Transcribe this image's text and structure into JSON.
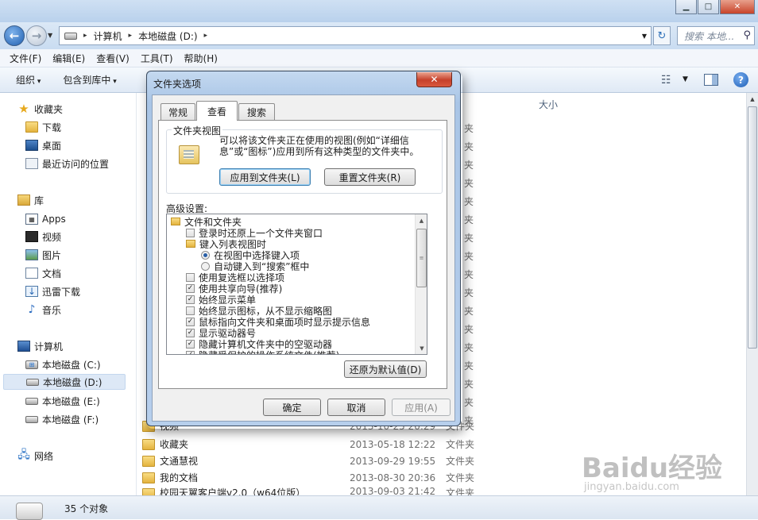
{
  "window": {
    "controls": {
      "minimize": "▁",
      "maximize": "□",
      "close": "✕"
    }
  },
  "address": {
    "crumbs": [
      "计算机",
      "本地磁盘 (D:)"
    ],
    "search_placeholder": "搜索 本地..."
  },
  "menu": [
    "文件(F)",
    "编辑(E)",
    "查看(V)",
    "工具(T)",
    "帮助(H)"
  ],
  "toolbar": {
    "organize": "组织",
    "include_in_library": "包含到库中",
    "help": "?"
  },
  "nav": {
    "favorites": "收藏夹",
    "downloads": "下载",
    "desktop": "桌面",
    "recent": "最近访问的位置",
    "libraries": "库",
    "apps": "Apps",
    "videos": "视频",
    "pictures": "图片",
    "documents": "文档",
    "thunder": "迅雷下载",
    "music": "音乐",
    "computer": "计算机",
    "drive_c": "本地磁盘 (C:)",
    "drive_d": "本地磁盘 (D:)",
    "drive_e": "本地磁盘 (E:)",
    "drive_f": "本地磁盘 (F:)",
    "network": "网络"
  },
  "content": {
    "size_header": "大小",
    "hidden_type_fragment": "夹",
    "rows": [
      {
        "name": "视频",
        "date": "2013-10-25 20:29",
        "type": "文件夹"
      },
      {
        "name": "收藏夹",
        "date": "2013-05-18 12:22",
        "type": "文件夹"
      },
      {
        "name": "文通慧视",
        "date": "2013-09-29 19:55",
        "type": "文件夹"
      },
      {
        "name": "我的文档",
        "date": "2013-08-30 20:36",
        "type": "文件夹"
      },
      {
        "name": "校园天翼客户端v2.0（w64位版）",
        "date": "2013-09-03 21:42",
        "type": "文件夹"
      }
    ]
  },
  "status": {
    "count": "35 个对象"
  },
  "watermark": {
    "brand": "Baidu经验",
    "url": "jingyan.baidu.com"
  },
  "dialog": {
    "title": "文件夹选项",
    "close": "✕",
    "tabs": [
      "常规",
      "查看",
      "搜索"
    ],
    "folder_views": {
      "legend": "文件夹视图",
      "text": "可以将该文件夹正在使用的视图(例如“详细信息”或“图标”)应用到所有这种类型的文件夹中。",
      "apply_button": "应用到文件夹(L)",
      "reset_button": "重置文件夹(R)"
    },
    "advanced_label": "高级设置:",
    "tree": [
      {
        "label": "文件和文件夹",
        "kind": "folder"
      },
      {
        "label": "登录时还原上一个文件夹窗口",
        "kind": "check",
        "checked": false
      },
      {
        "label": "键入列表视图时",
        "kind": "folder"
      },
      {
        "label": "在视图中选择键入项",
        "kind": "radio",
        "checked": true
      },
      {
        "label": "自动键入到“搜索”框中",
        "kind": "radio",
        "checked": false
      },
      {
        "label": "使用复选框以选择项",
        "kind": "check",
        "checked": false
      },
      {
        "label": "使用共享向导(推荐)",
        "kind": "check",
        "checked": true
      },
      {
        "label": "始终显示菜单",
        "kind": "check",
        "checked": true
      },
      {
        "label": "始终显示图标，从不显示缩略图",
        "kind": "check",
        "checked": false
      },
      {
        "label": "鼠标指向文件夹和桌面项时显示提示信息",
        "kind": "check",
        "checked": true
      },
      {
        "label": "显示驱动器号",
        "kind": "check",
        "checked": true
      },
      {
        "label": "隐藏计算机文件夹中的空驱动器",
        "kind": "check",
        "checked": true
      },
      {
        "label": "隐藏受保护的操作系统文件(推荐)",
        "kind": "check",
        "checked": true
      }
    ],
    "restore_defaults": "还原为默认值(D)",
    "ok": "确定",
    "cancel": "取消",
    "apply": "应用(A)"
  }
}
